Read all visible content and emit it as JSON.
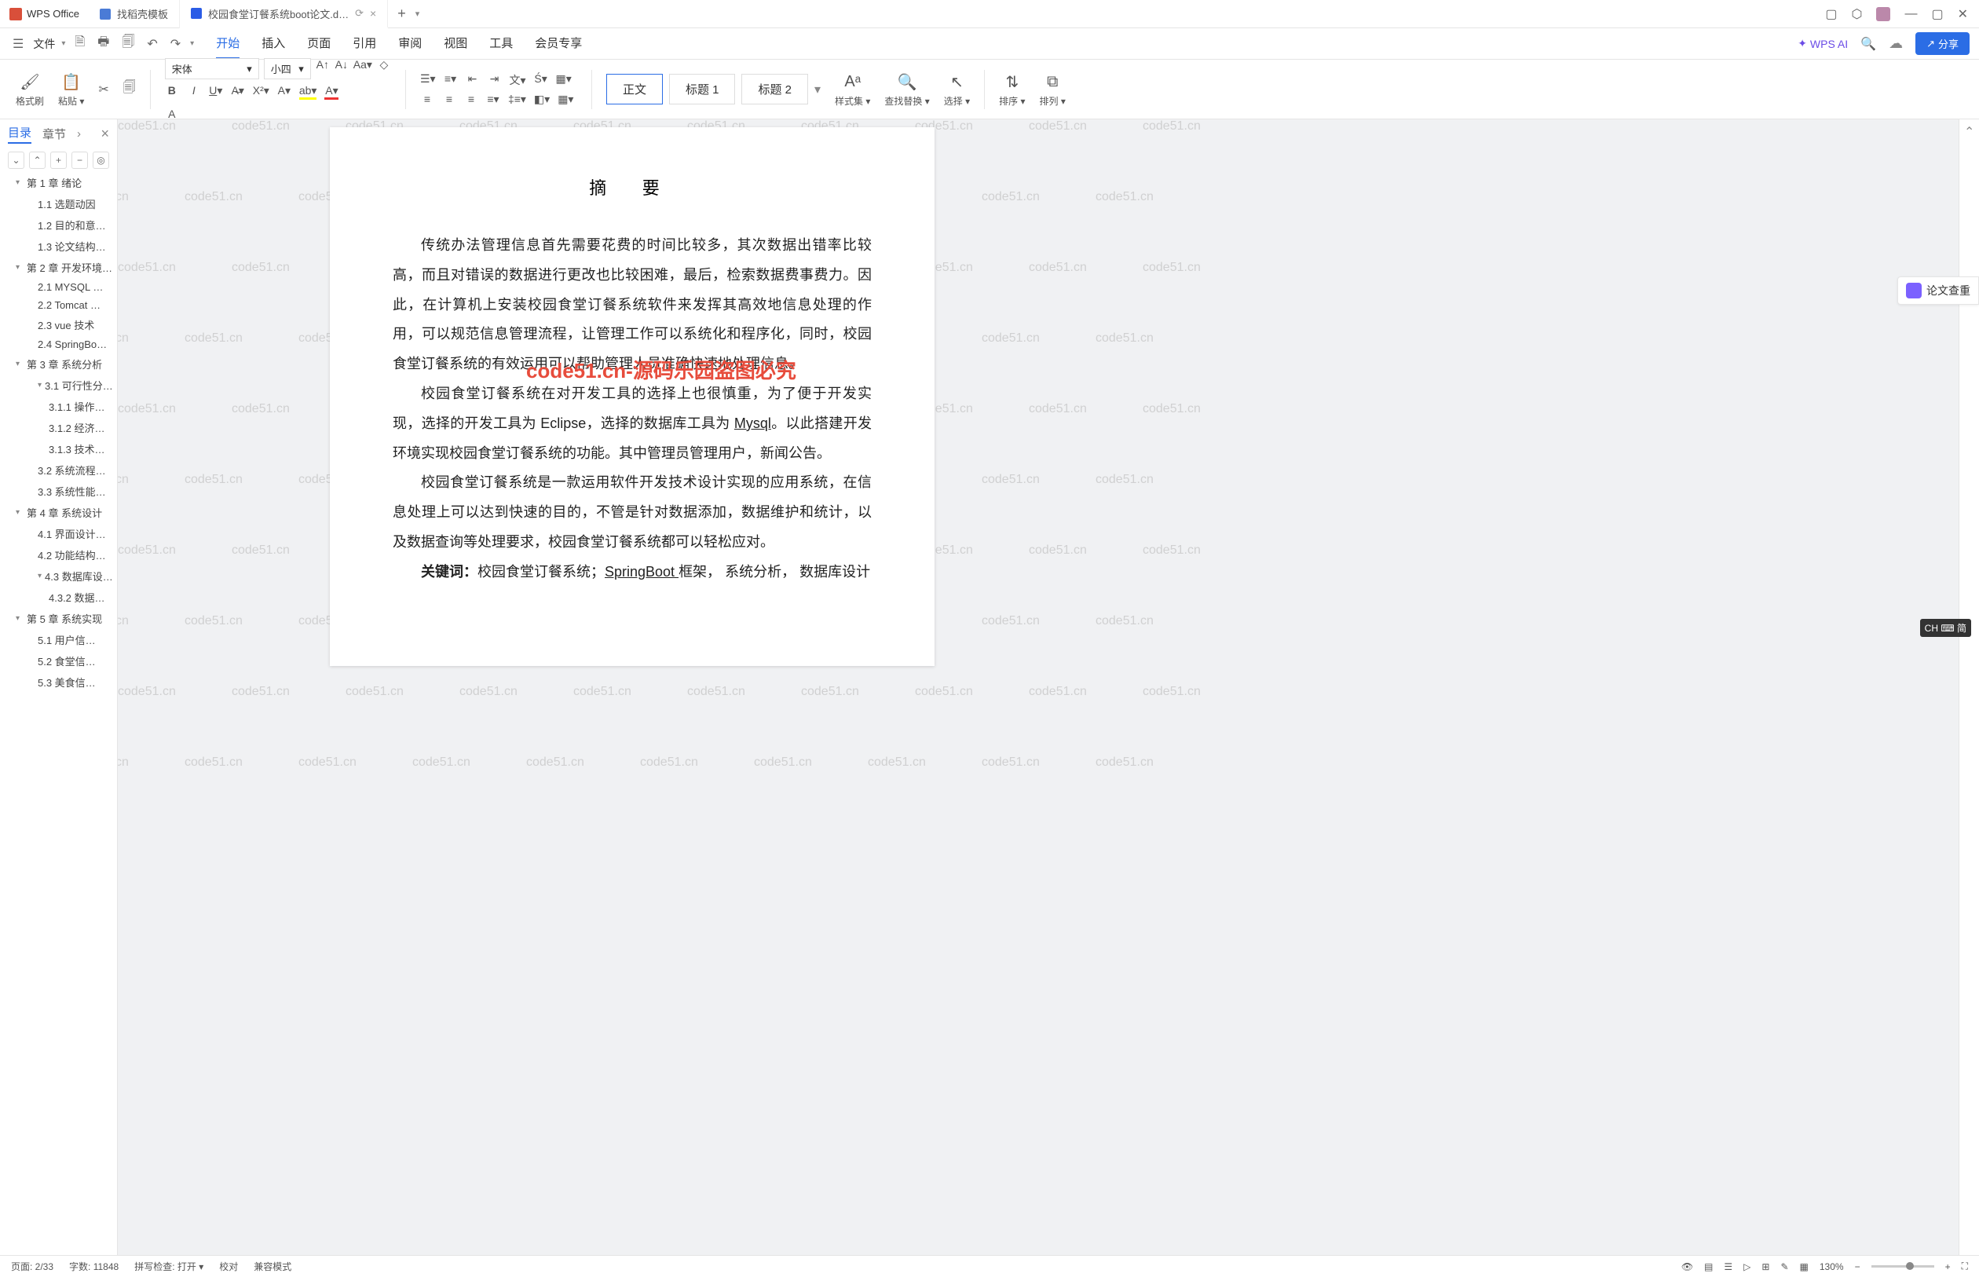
{
  "app": {
    "name": "WPS Office"
  },
  "tabs": [
    {
      "label": "找稻壳模板",
      "icon": "template"
    },
    {
      "label": "校园食堂订餐系统boot论文.d…",
      "icon": "doc",
      "active": true
    }
  ],
  "titlebar_icons": [
    "layout",
    "cube",
    "avatar",
    "min",
    "max",
    "close"
  ],
  "menubar": {
    "left_icons": [
      "menu",
      "file",
      "new",
      "open",
      "save",
      "print",
      "undo",
      "redo",
      "dropdown"
    ],
    "file_label": "文件",
    "tabs": [
      "开始",
      "插入",
      "页面",
      "引用",
      "审阅",
      "视图",
      "工具",
      "会员专享"
    ],
    "active": "开始",
    "ai": "WPS AI",
    "share": "分享",
    "cloud_icon": "☁"
  },
  "ribbon": {
    "format_brush": "格式刷",
    "paste": "粘贴",
    "font_name": "宋体",
    "font_size": "小四",
    "styles": {
      "normal": "正文",
      "h1": "标题 1",
      "h2": "标题 2"
    },
    "styleset": "样式集",
    "findreplace": "查找替换",
    "select": "选择",
    "sort": "排序",
    "arrange": "排列"
  },
  "sidebar": {
    "tabs": {
      "toc": "目录",
      "chapter": "章节"
    },
    "close": "×",
    "outline": [
      {
        "l": 0,
        "t": "第 1 章  绪论",
        "c": 1
      },
      {
        "l": 1,
        "t": "1.1 选题动因"
      },
      {
        "l": 1,
        "t": "1.2 目的和意…"
      },
      {
        "l": 1,
        "t": "1.3 论文结构…"
      },
      {
        "l": 0,
        "t": "第 2 章  开发环境…",
        "c": 1
      },
      {
        "l": 1,
        "t": "2.1 MYSQL …"
      },
      {
        "l": 1,
        "t": "2.2 Tomcat …"
      },
      {
        "l": 1,
        "t": "2.3 vue 技术"
      },
      {
        "l": 1,
        "t": "2.4 SpringBo…"
      },
      {
        "l": 0,
        "t": "第 3 章  系统分析",
        "c": 1
      },
      {
        "l": 1,
        "t": "3.1 可行性分…",
        "c": 1
      },
      {
        "l": 2,
        "t": "3.1.1 操作…"
      },
      {
        "l": 2,
        "t": "3.1.2 经济…"
      },
      {
        "l": 2,
        "t": "3.1.3 技术…"
      },
      {
        "l": 1,
        "t": "3.2 系统流程…"
      },
      {
        "l": 1,
        "t": "3.3 系统性能…"
      },
      {
        "l": 0,
        "t": "第 4 章  系统设计",
        "c": 1
      },
      {
        "l": 1,
        "t": "4.1 界面设计…"
      },
      {
        "l": 1,
        "t": "4.2 功能结构…"
      },
      {
        "l": 1,
        "t": "4.3 数据库设…",
        "c": 1
      },
      {
        "l": 2,
        "t": "4.3.2 数据…"
      },
      {
        "l": 0,
        "t": "第 5 章  系统实现",
        "c": 1
      },
      {
        "l": 1,
        "t": "5.1 用户信…"
      },
      {
        "l": 1,
        "t": "5.2 食堂信…"
      },
      {
        "l": 1,
        "t": "5.3 美食信…"
      }
    ]
  },
  "doc": {
    "title": "摘  要",
    "p1": "传统办法管理信息首先需要花费的时间比较多，其次数据出错率比较高，而且对错误的数据进行更改也比较困难，最后，检索数据费事费力。因此，在计算机上安装校园食堂订餐系统软件来发挥其高效地信息处理的作用，可以规范信息管理流程，让管理工作可以系统化和程序化，同时，校园食堂订餐系统的有效运用可以帮助管理人员准确快速地处理信息。",
    "p2a": "校园食堂订餐系统在对开发工具的选择上也很慎重，为了便于开发实现，选择的开发工具为 Eclipse，选择的数据库工具为 ",
    "p2_db": "Mysql",
    "p2b": "。以此搭建开发环境实现校园食堂订餐系统的功能。其中管理员管理用户，新闻公告。",
    "p3": "校园食堂订餐系统是一款运用软件开发技术设计实现的应用系统，在信息处理上可以达到快速的目的，不管是针对数据添加，数据维护和统计，以及数据查询等处理要求，校园食堂订餐系统都可以轻松应对。",
    "kw_label": "关键词：",
    "kw_a": "校园食堂订餐系统；",
    "kw_sb": "SpringBoot ",
    "kw_b": "框架， 系统分析， 数据库设计"
  },
  "watermark": "code51.cn",
  "wm_red": "code51.cn-源码乐园盗图必究",
  "plagiarism": "论文查重",
  "status": {
    "page": "页面: 2/33",
    "words": "字数: 11848",
    "spell": "拼写检查: 打开",
    "proof": "校对",
    "compat": "兼容模式",
    "zoom": "130%"
  },
  "ime": "CH ⌨ 简"
}
